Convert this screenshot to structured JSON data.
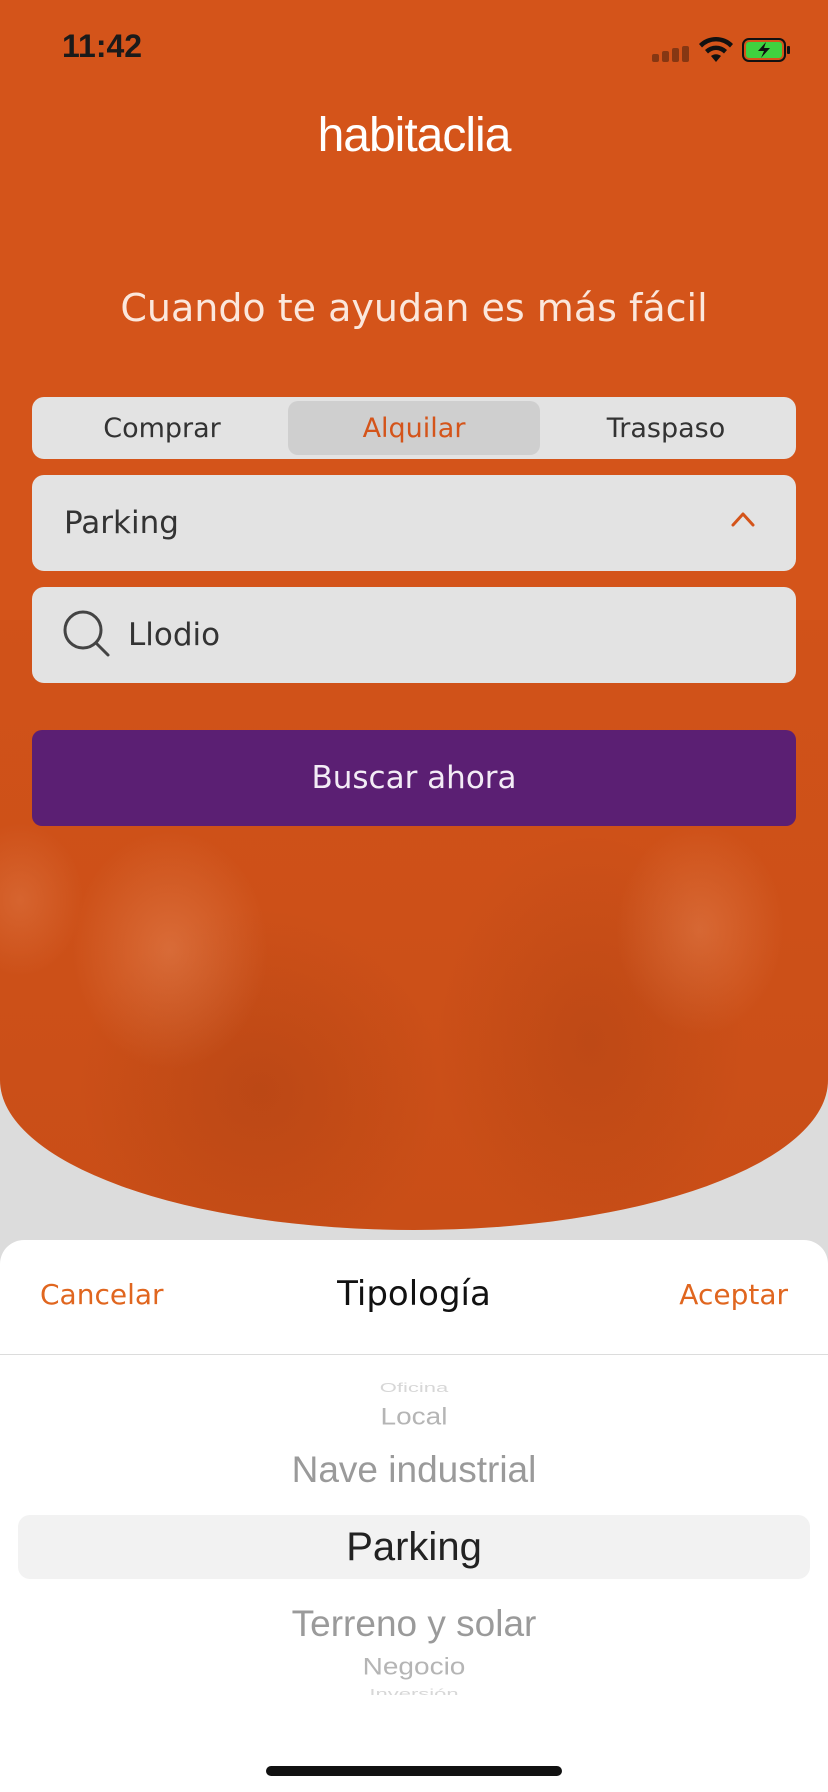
{
  "status_bar": {
    "time": "11:42",
    "battery_color": "#3fd13f"
  },
  "brand": {
    "logo_text": "habitaclia",
    "accent_color": "#d4541a",
    "button_color": "#5b1f73"
  },
  "headline": "Cuando te ayudan es más fácil",
  "operation_tabs": [
    {
      "label": "Comprar",
      "active": false
    },
    {
      "label": "Alquilar",
      "active": true
    },
    {
      "label": "Traspaso",
      "active": false
    }
  ],
  "type_field": {
    "value": "Parking",
    "icon": "chevron-up-icon"
  },
  "location_field": {
    "value": "Llodio",
    "icon": "search-icon"
  },
  "search_button": {
    "label": "Buscar ahora"
  },
  "picker_sheet": {
    "cancel_label": "Cancelar",
    "title": "Tipología",
    "accept_label": "Aceptar",
    "options": [
      "Oficina",
      "Local",
      "Nave industrial",
      "Parking",
      "Terreno y solar",
      "Negocio",
      "Inversión"
    ],
    "selected": "Parking"
  }
}
